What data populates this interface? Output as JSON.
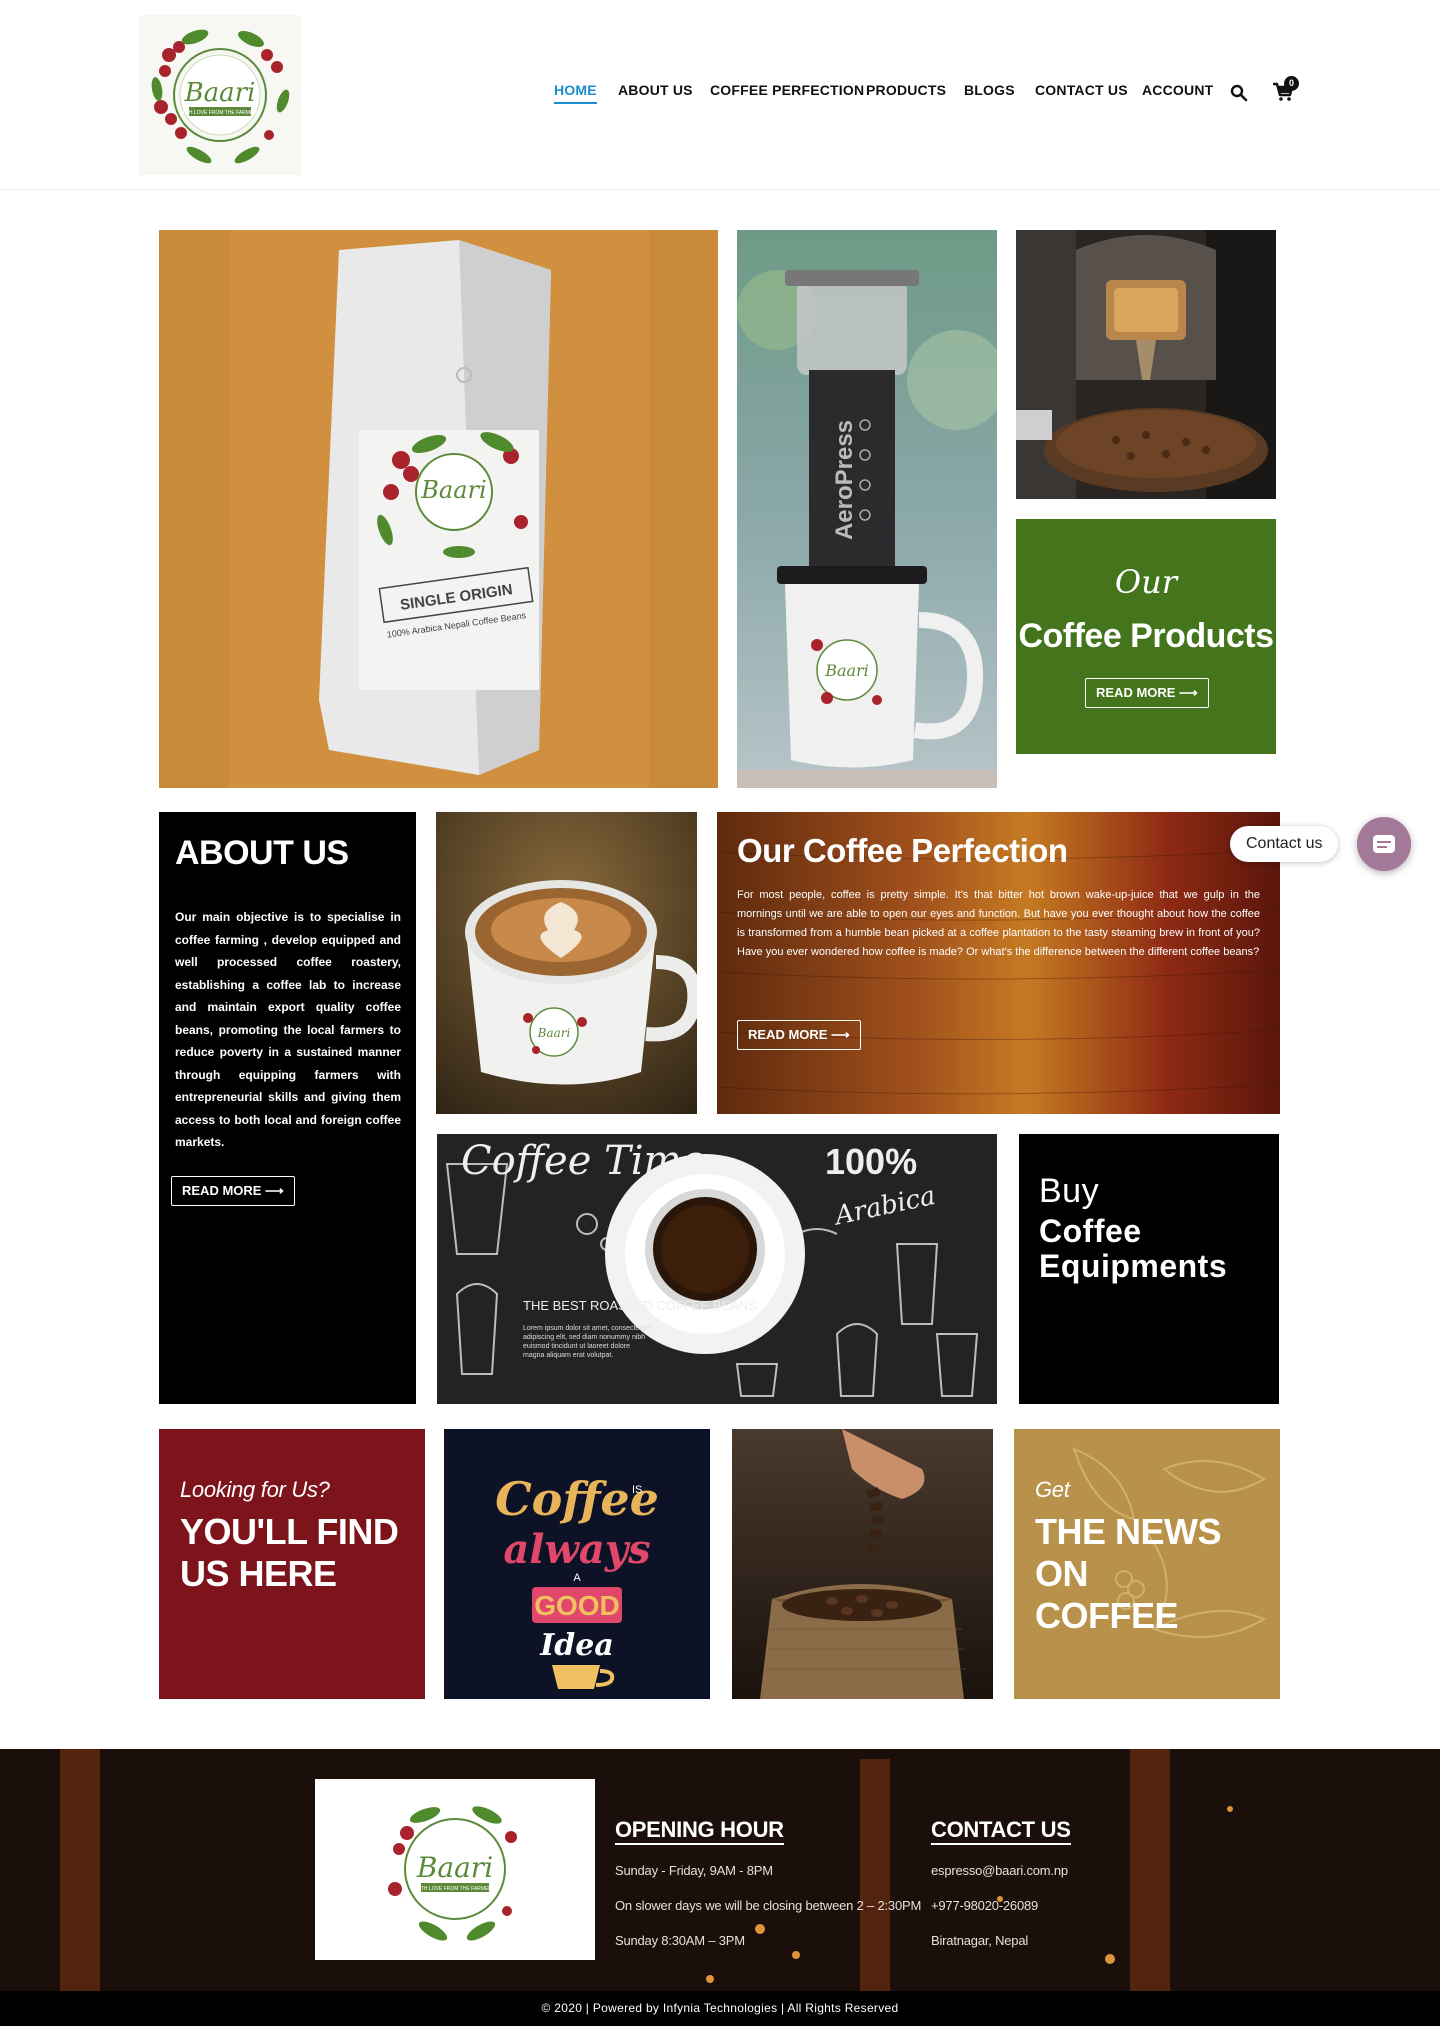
{
  "header": {
    "nav": [
      {
        "label": "HOME",
        "active": true
      },
      {
        "label": "ABOUT US"
      },
      {
        "label": "COFFEE PERFECTION"
      },
      {
        "label": "PRODUCTS"
      },
      {
        "label": "BLOGS"
      },
      {
        "label": "CONTACT US"
      },
      {
        "label": "ACCOUNT"
      }
    ],
    "cart_count": "0",
    "icons": [
      "search-icon",
      "cart-icon"
    ],
    "logo_text": {
      "brand": "Baari",
      "tagline": "WITH LOVE FROM THE FARMERS"
    }
  },
  "products_tile": {
    "script": "Our",
    "title": "Coffee Products",
    "button": "READ MORE ⟶"
  },
  "about": {
    "title": "ABOUT US",
    "text": "Our main objective is to specialise in coffee farming , develop equipped and well processed coffee roastery, establishing a coffee lab to increase and maintain export quality coffee beans, promoting the local farmers to reduce poverty in a sustained manner through equipping farmers with entrepreneurial skills and giving them access to both local and foreign coffee markets.",
    "button": "READ MORE ⟶"
  },
  "perfection": {
    "title": "Our Coffee Perfection",
    "text": "For most people, coffee is pretty simple. It's that bitter hot brown wake-up-juice that we gulp in the mornings until we are able to open our eyes and function. But have you ever thought about how the coffee is transformed from a humble bean picked at a coffee plantation to the tasty steaming brew in front of you? Have you ever wondered how coffee is made? Or what's the difference between the different coffee beans?",
    "button": "READ MORE ⟶"
  },
  "coffee_time": {
    "heading": "Coffee Time",
    "badge": "100%",
    "arabica": "Arabica",
    "roasted": "THE BEST ROASTED COFFEE BEANS",
    "lorem": "Lorem ipsum dolor sit amet, consectetuer adipiscing elit, sed diam nonummy nibh euismod tincidunt ut laoreet dolore magna aliquam erat volutpat."
  },
  "equipments": {
    "line1": "Buy",
    "line2": "Coffee",
    "line3": "Equipments"
  },
  "find_us": {
    "small": "Looking for Us?",
    "big": "YOU'LL FIND US HERE"
  },
  "idea": {
    "coffee": "Coffee",
    "is": "IS",
    "always": "always",
    "a": "A",
    "good": "GOOD",
    "idea": "Idea"
  },
  "news": {
    "small": "Get",
    "big_lines": [
      "THE NEWS",
      "ON",
      "COFFEE"
    ]
  },
  "aeropress": {
    "brand": "AeroPress"
  },
  "bag": {
    "label": "SINGLE ORIGIN",
    "sub": "100% Arabica Nepali Coffee Beans"
  },
  "contact_widget": {
    "label": "Contact us"
  },
  "footer": {
    "opening": {
      "title": "OPENING HOUR",
      "lines": [
        "Sunday - Friday, 9AM - 8PM",
        "On slower days we will be closing between 2 – 2:30PM",
        "Sunday 8:30AM – 3PM"
      ]
    },
    "contact": {
      "title": "CONTACT US",
      "lines": [
        "espresso@baari.com.np",
        "+977-98020-26089",
        "Biratnagar, Nepal"
      ]
    },
    "copyright": "© 2020 | Powered by Infynia Technologies | All Rights Reserved"
  },
  "colors": {
    "accent": "#1a8fce",
    "products_green": "#44741c",
    "find_red": "#7d141b",
    "news_gold": "#b8914a",
    "idea_navy": "#0e1226"
  }
}
